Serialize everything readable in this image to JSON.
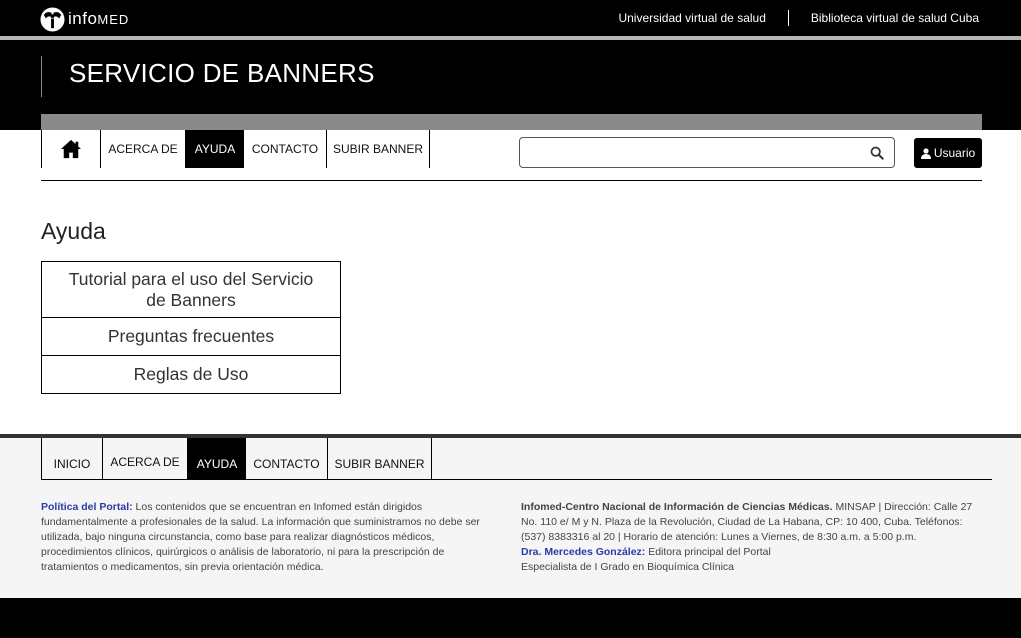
{
  "topbar": {
    "logo_text": "info",
    "logo_text_sc": "MED",
    "links": [
      "Universidad virtual de salud",
      "Biblioteca virtual de salud Cuba"
    ]
  },
  "header": {
    "title": "SERVICIO DE BANNERS"
  },
  "nav": {
    "items": [
      "ACERCA DE",
      "AYUDA",
      "CONTACTO",
      "SUBIR BANNER"
    ],
    "active": "AYUDA",
    "home_icon": "home-icon"
  },
  "search": {
    "value": "",
    "placeholder": "",
    "icon": "search-icon"
  },
  "user_button": {
    "label": "Usuario",
    "icon": "user-icon"
  },
  "main": {
    "title": "Ayuda",
    "help_items": [
      "Tutorial para el uso del Servicio de Banners",
      "Preguntas frecuentes",
      "Reglas de Uso"
    ]
  },
  "footer": {
    "nav": [
      "INICIO",
      "ACERCA DE",
      "AYUDA",
      "CONTACTO",
      "SUBIR BANNER"
    ],
    "policy_label": "Política del Portal:",
    "policy_text": " Los contenidos que se encuentran en Infomed están dirigidos fundamentalmente a profesionales de la salud. La información que suministramos no debe ser utilizada, bajo ninguna circunstancia, como base para realizar diagnósticos médicos, procedimientos clínicos, quirúrgicos o análisis de laboratorio, ni para la prescripción de tratamientos o medicamentos, sin previa orientación médica.",
    "org_name": "Infomed-Centro Nacional de Información de Ciencias Médicas.",
    "org_text": " MINSAP | Dirección: Calle 27 No. 110 e/ M y N. Plaza de la Revolución, Ciudad de La Habana, CP: 10 400, Cuba. Teléfonos: (537) 8383316 al 20 | Horario de atención: Lunes a Viernes, de 8:30 a.m. a 5:00 p.m.",
    "editor_name": "Dra. Mercedes González:",
    "editor_role": " Editora principal del Portal",
    "editor_specialty": "Especialista de I Grado en Bioquímica Clínica"
  },
  "colors": {
    "link_blue": "#2c3aa8",
    "black": "#000000",
    "footer_bg": "#f5f5f5"
  }
}
